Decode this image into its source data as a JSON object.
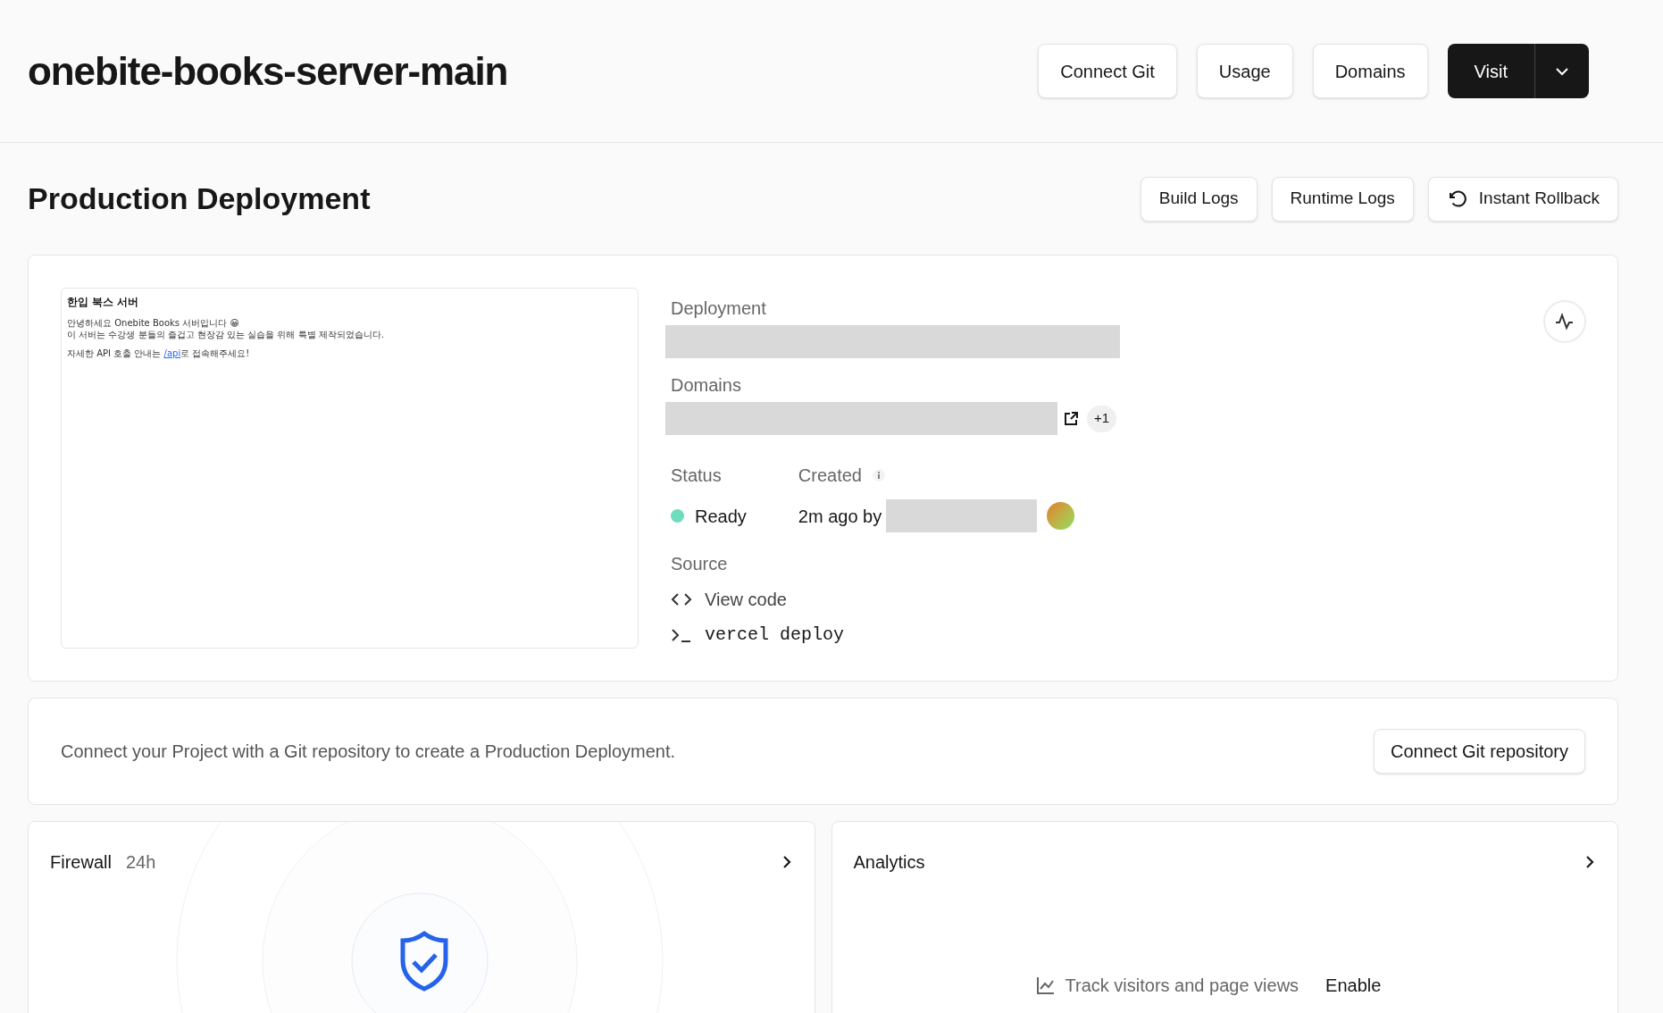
{
  "project": {
    "title": "onebite-books-server-main",
    "actions": [
      "Connect Git",
      "Usage",
      "Domains"
    ],
    "visit": "Visit"
  },
  "production": {
    "title": "Production Deployment",
    "actions": [
      {
        "label": "Build Logs",
        "kind": "plain"
      },
      {
        "label": "Runtime Logs",
        "kind": "plain"
      },
      {
        "label": "Instant Rollback",
        "kind": "rollback"
      }
    ]
  },
  "deployment": {
    "preview": {
      "heading": "한입 북스 서버",
      "lines": [
        "안녕하세요 Onebite Books 서버입니다 😀",
        "이 서버는 수강생 분들의 즐겁고 현장감 있는 실습을 위해 특별 제작되었습니다."
      ],
      "api_before": "자세한 API 호출 안내는 ",
      "api_link": "/api",
      "api_after": "로 접속해주세요!"
    },
    "deployment_label": "Deployment",
    "domains_label": "Domains",
    "domains_extra": "+1",
    "status_label": "Status",
    "created_label": "Created",
    "status": {
      "label": "Ready",
      "color": "#6fdcc0"
    },
    "created": "2m ago by",
    "source_label": "Source",
    "source": [
      {
        "kind": "code",
        "label": "View code"
      },
      {
        "kind": "cli",
        "label": "vercel deploy"
      }
    ]
  },
  "git_notice": {
    "text": "Connect your Project with a Git repository to create a Production Deployment.",
    "button": "Connect Git repository"
  },
  "firewall": {
    "title": "Firewall",
    "period": "24h"
  },
  "analytics": {
    "title": "Analytics",
    "hint": "Track visitors and page views",
    "action": "Enable"
  }
}
